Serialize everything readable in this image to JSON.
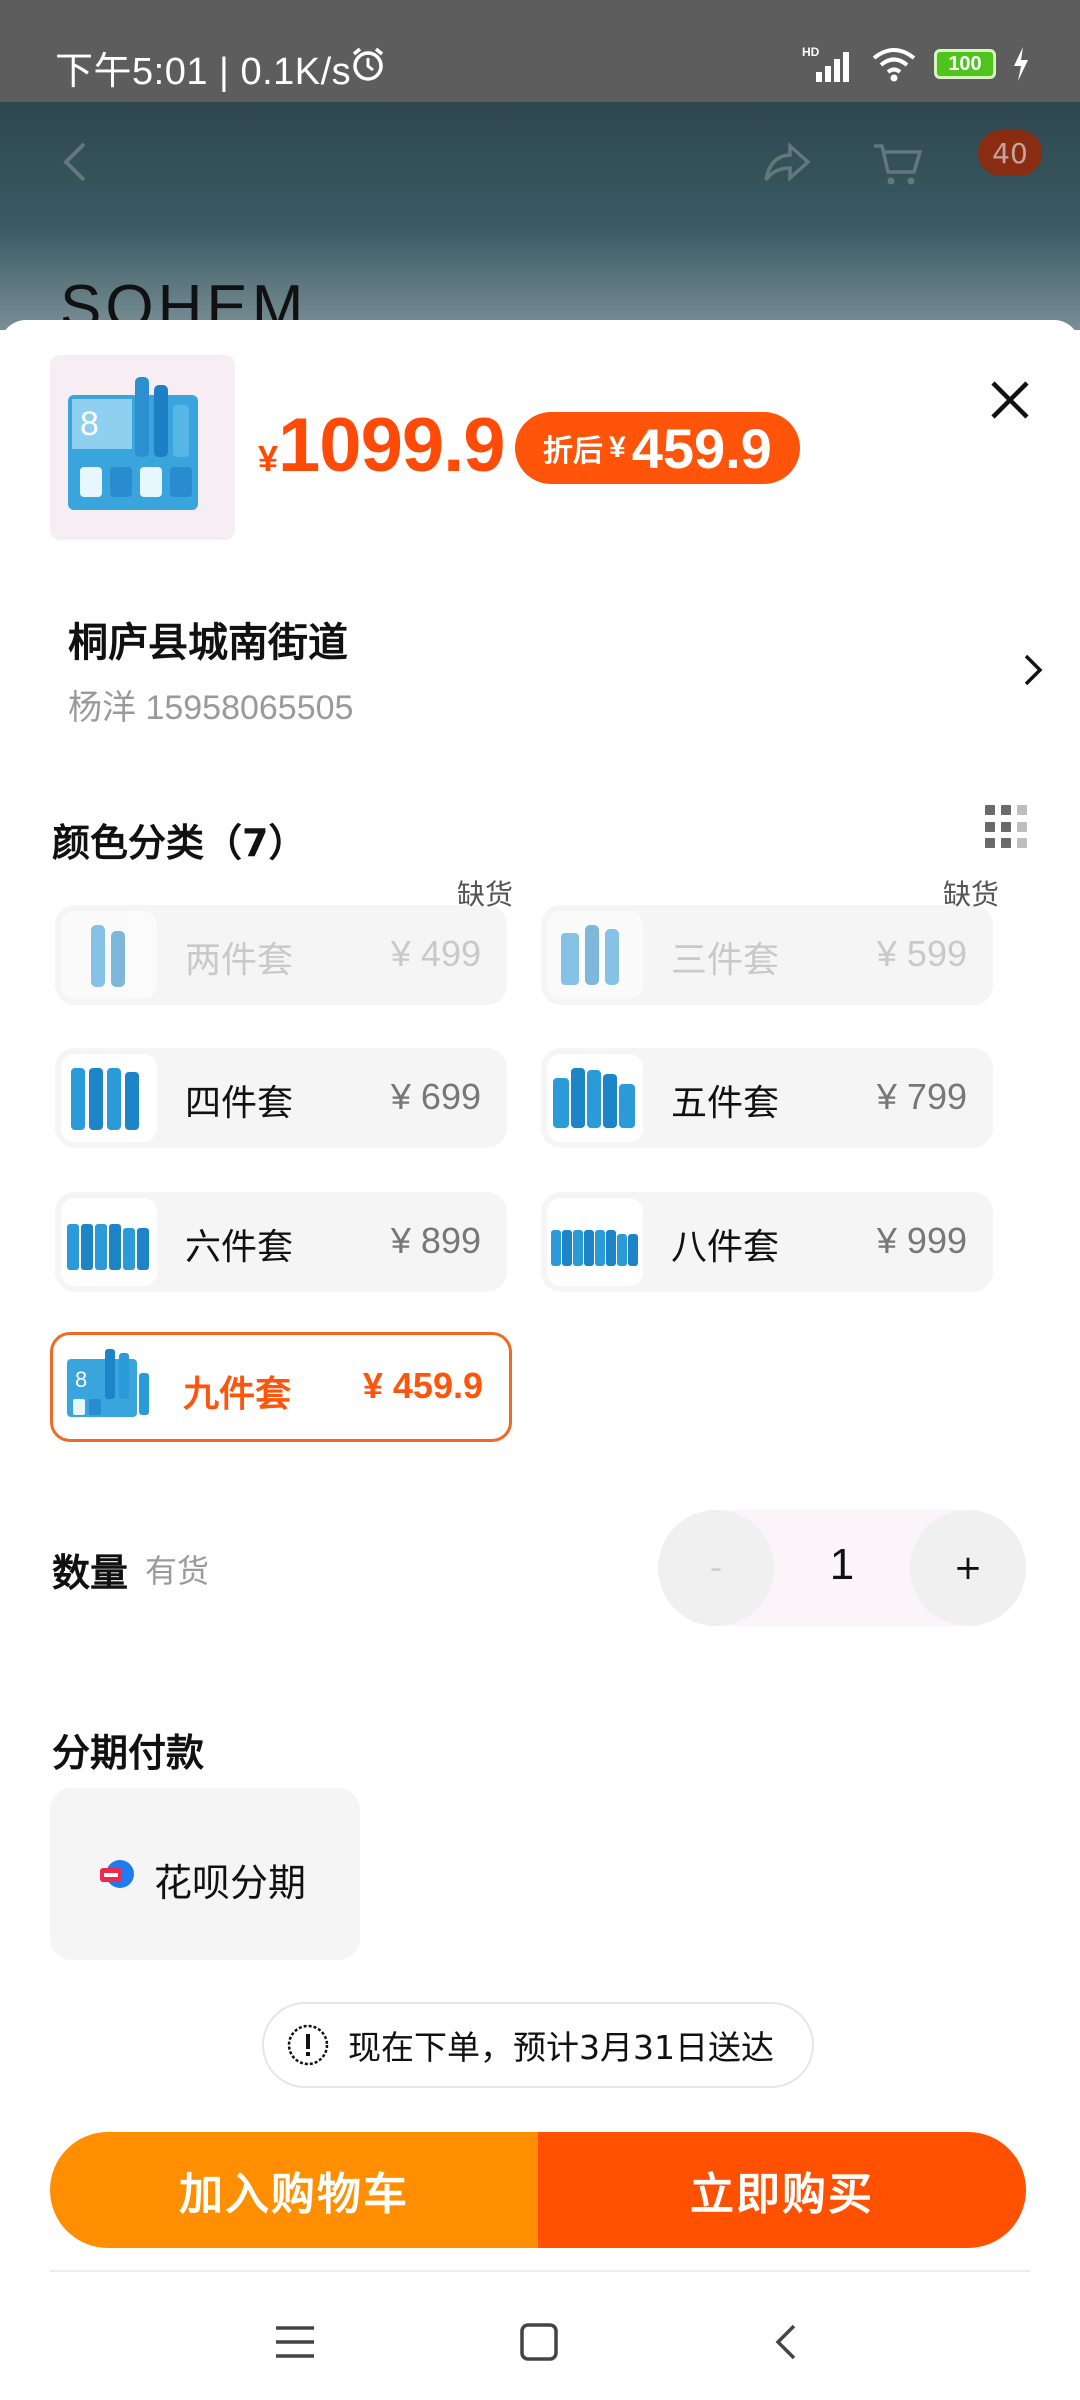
{
  "status_bar": {
    "time_speed": "下午5:01 | 0.1K/s",
    "network": "HD",
    "battery": "100"
  },
  "background_page": {
    "brand": "SOHEM",
    "cart_count": "40"
  },
  "product": {
    "currency": "¥",
    "original_price": "1099.9",
    "discount_label": "折后",
    "discount_price": "459.9"
  },
  "address": {
    "line1": "桐庐县城南街道",
    "contact": "杨洋 15958065505"
  },
  "variants": {
    "title": "颜色分类（7）",
    "items": [
      {
        "name": "两件套",
        "price": "¥ 499",
        "tag": "缺货"
      },
      {
        "name": "三件套",
        "price": "¥ 599",
        "tag": "缺货"
      },
      {
        "name": "四件套",
        "price": "¥ 699"
      },
      {
        "name": "五件套",
        "price": "¥ 799"
      },
      {
        "name": "六件套",
        "price": "¥ 899"
      },
      {
        "name": "八件套",
        "price": "¥ 999"
      },
      {
        "name": "九件套",
        "price": "¥ 459.9"
      }
    ],
    "selected": "九件套"
  },
  "quantity": {
    "label": "数量",
    "stock_status": "有货",
    "minus": "-",
    "value": "1",
    "plus": "+"
  },
  "installment": {
    "title": "分期付款",
    "option": "花呗分期"
  },
  "delivery": {
    "text": "现在下单，预计3月31日送达"
  },
  "actions": {
    "add_to_cart": "加入购物车",
    "buy_now": "立即购买"
  },
  "colors": {
    "accent": "#ff5409",
    "cart_button": "#ff8f00",
    "buy_button": "#ff5100"
  }
}
